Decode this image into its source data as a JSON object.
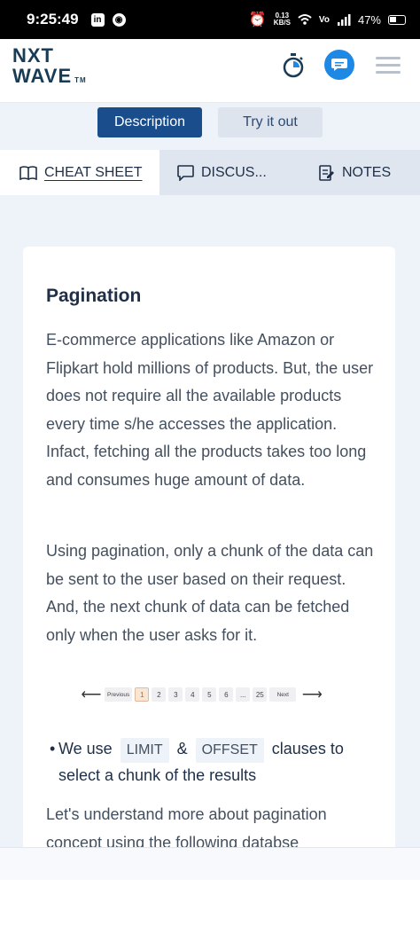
{
  "status_bar": {
    "time": "9:25:49",
    "speed_value": "0.13",
    "speed_unit": "KB/S",
    "battery": "47%"
  },
  "header": {
    "logo_top": "NXT",
    "logo_bottom": "WAVE",
    "logo_tm": "TM"
  },
  "toggle": {
    "description_label": "Description",
    "try_label": "Try it out"
  },
  "tabs": {
    "cheat_sheet": "CHEAT SHEET",
    "discuss": "DISCUS...",
    "notes": "NOTES"
  },
  "content": {
    "title": "Pagination",
    "para1": "E-commerce applications like Amazon or Flipkart hold millions of products. But, the user does not require all the available products every time s/he accesses the application. Infact, fetching all the products takes too long and consumes huge amount of data.",
    "para2": "Using pagination, only a chunk of the data can be sent to the user based on their request. And, the next chunk of data can be fetched only when the user asks for it.",
    "pager": {
      "left_arrow": "⟵",
      "right_arrow": "⟶",
      "previous": "Previous",
      "next": "Next",
      "pages": [
        "1",
        "2",
        "3",
        "4",
        "5",
        "6",
        "...",
        "25"
      ],
      "active_page": "1"
    },
    "bullet_pre": "We use",
    "chip_limit": "LIMIT",
    "bullet_amp": "&",
    "chip_offset": "OFFSET",
    "bullet_post": "clauses to select a chunk of the results",
    "para3": "Let's understand more about pagination concept using the following databse"
  }
}
